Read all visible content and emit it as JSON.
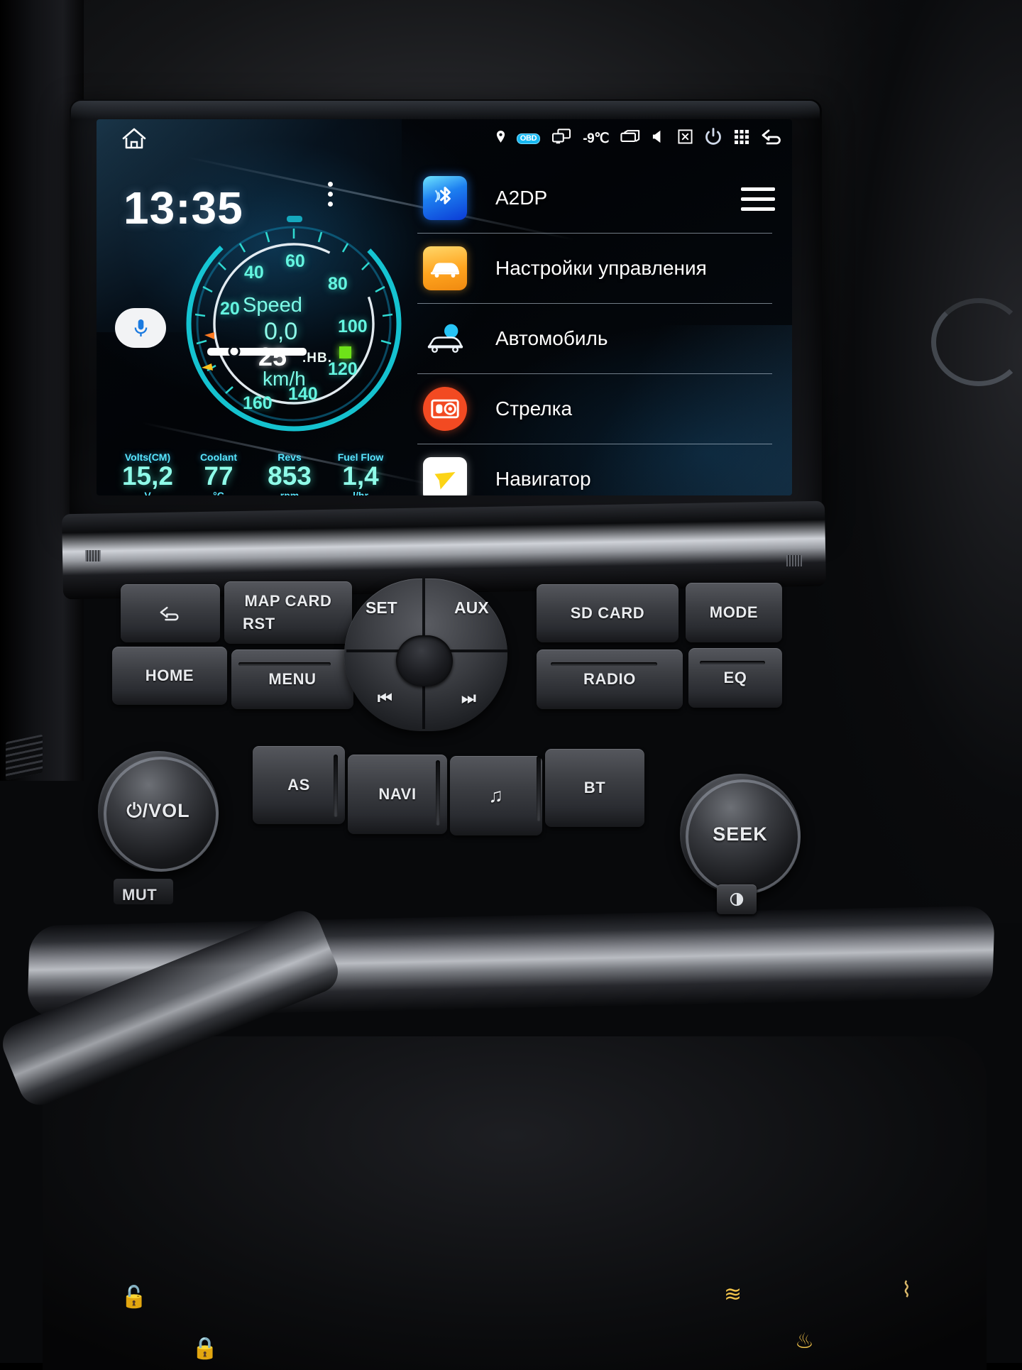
{
  "device": {
    "name": "Android car head unit",
    "vehicle_controls_label": "center console"
  },
  "status_bar": {
    "home_icon": "home-icon",
    "icons": [
      {
        "name": "location-pin-icon",
        "label": ""
      },
      {
        "name": "obd-badge-icon",
        "label": "OBD"
      },
      {
        "name": "screen-mirror-icon",
        "label": ""
      },
      {
        "name": "temperature-readout",
        "label": "-9℃"
      },
      {
        "name": "window-icon",
        "label": ""
      },
      {
        "name": "volume-icon",
        "label": ""
      },
      {
        "name": "close-box-icon",
        "label": ""
      },
      {
        "name": "power-icon",
        "label": ""
      },
      {
        "name": "apps-grid-icon",
        "label": ""
      },
      {
        "name": "back-icon",
        "label": ""
      }
    ],
    "temperature": "-9℃",
    "obd_label": "OBD"
  },
  "home": {
    "clock": "13:35",
    "overflow_icon": "kebab-menu-icon",
    "mic_icon": "microphone-icon",
    "menu_icon": "hamburger-menu-icon"
  },
  "gauge": {
    "title": "Speed",
    "value": "0,0",
    "unit": "km/h",
    "needle_value": "25",
    "hb_label": ".HB.",
    "tick_labels": [
      "20",
      "40",
      "60",
      "80",
      "100",
      "120",
      "140",
      "160"
    ],
    "accent_color": "#64f5e0",
    "ring_color": "#22e0e8"
  },
  "readouts": [
    {
      "name": "Volts(CM)",
      "value": "15,2",
      "unit": "V"
    },
    {
      "name": "Coolant",
      "value": "77",
      "unit": "°C"
    },
    {
      "name": "Revs",
      "value": "853",
      "unit": "rpm"
    },
    {
      "name": "Fuel Flow",
      "value": "1,4",
      "unit": "l/hr"
    }
  ],
  "app_list": [
    {
      "label": "A2DP",
      "icon": "bluetooth-icon"
    },
    {
      "label": "Настройки управления",
      "icon": "car-settings-icon"
    },
    {
      "label": "Автомобиль",
      "icon": "vehicle-icon"
    },
    {
      "label": "Стрелка",
      "icon": "radar-detector-icon"
    },
    {
      "label": "Навигатор",
      "icon": "navigator-arrow-icon"
    }
  ],
  "controls": {
    "back_icon": "back-arrow-icon",
    "map_card": "MAP CARD",
    "rst": "RST",
    "set": "SET",
    "aux": "AUX",
    "sd_card": "SD CARD",
    "mode": "MODE",
    "home": "HOME",
    "menu": "MENU",
    "radio": "RADIO",
    "eq": "EQ",
    "prev_icon": "previous-track-icon",
    "next_icon": "next-track-icon",
    "as": "AS",
    "navi": "NAVI",
    "music_icon": "music-note-icon",
    "bt": "BT",
    "vol_knob": "⏻/VOL",
    "seek_knob": "SEEK",
    "mut": "MUT",
    "brightness_icon": "brightness-icon"
  },
  "hvac": {
    "icons": [
      "lock-icon",
      "lock-icon",
      "rear-defrost-icon",
      "seat-heater-icon"
    ]
  }
}
